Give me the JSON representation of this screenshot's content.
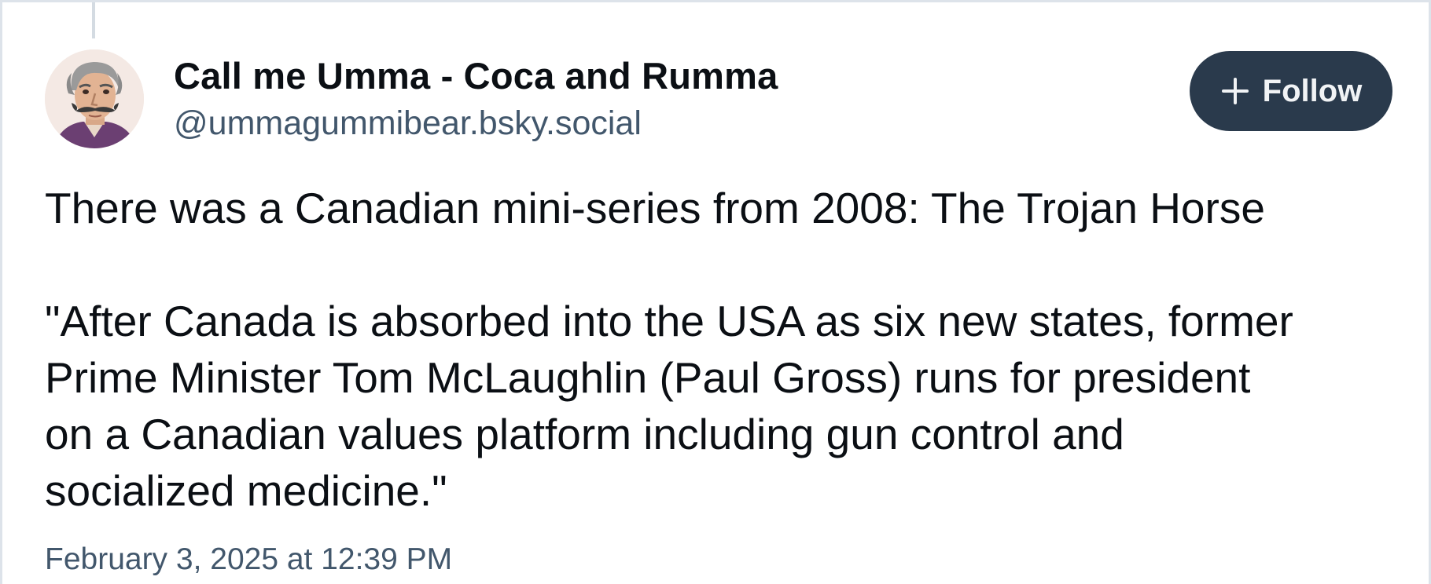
{
  "post": {
    "author": {
      "display_name": "Call me Umma - Coca and Rumma",
      "handle": "@ummagummibear.bsky.social",
      "avatar_icon": "mustached-man-portrait-avatar"
    },
    "follow_button": {
      "label": "Follow",
      "icon": "plus-icon"
    },
    "text": {
      "line_1": "There was a Canadian mini-series from 2008: The Trojan Horse",
      "line_2": "\"After Canada is absorbed into the USA as six new states, former",
      "line_3": "Prime Minister Tom McLaughlin (Paul Gross) runs for president",
      "line_4": "on a Canadian values platform including gun control and",
      "line_5": "socialized medicine.\""
    },
    "timestamp": "February 3, 2025 at 12:39 PM"
  },
  "colors": {
    "follow_button_bg": "#2a3a4c",
    "handle_text": "#42576c",
    "card_border": "#dde3ea"
  }
}
